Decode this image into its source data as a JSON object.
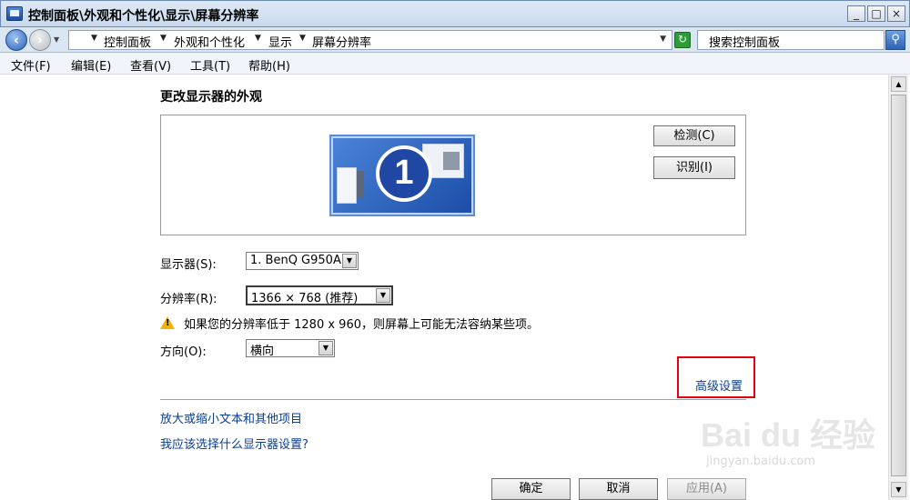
{
  "window": {
    "title": "控制面板\\外观和个性化\\显示\\屏幕分辨率",
    "min_label": "_",
    "max_label": "□",
    "close_label": "×"
  },
  "address": {
    "crumbs": [
      "控制面板",
      "外观和个性化",
      "显示",
      "屏幕分辨率"
    ],
    "search_placeholder": "搜索控制面板"
  },
  "menu": [
    "文件(F)",
    "编辑(E)",
    "查看(V)",
    "工具(T)",
    "帮助(H)"
  ],
  "page": {
    "heading": "更改显示器的外观",
    "monitor_number": "1",
    "detect_button": "检测(C)",
    "identify_button": "识别(I)",
    "display_label": "显示器(S):",
    "display_value": "1. BenQ G950A",
    "resolution_label": "分辨率(R):",
    "resolution_value": "1366 × 768 (推荐)",
    "warning": "如果您的分辨率低于 1280 x 960，则屏幕上可能无法容纳某些项。",
    "orientation_label": "方向(O):",
    "orientation_value": "横向",
    "advanced_link": "高级设置",
    "link_text_size": "放大或缩小文本和其他项目",
    "link_which_settings": "我应该选择什么显示器设置?",
    "ok_button": "确定",
    "cancel_button": "取消",
    "apply_button": "应用(A)"
  },
  "watermark": {
    "brand": "Bai du 经验",
    "url": "jingyan.baidu.com"
  },
  "colors": {
    "accent": "#2147a4",
    "link": "#0b3d91",
    "highlight_box": "#e4000f"
  }
}
